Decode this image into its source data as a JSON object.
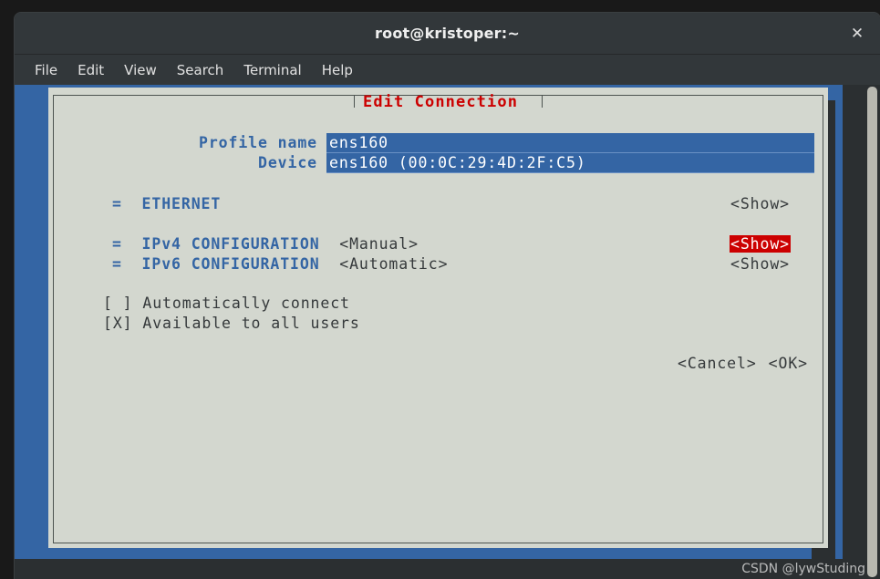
{
  "window": {
    "title": "root@kristoper:~",
    "close_icon": "close-icon",
    "close_glyph": "✕"
  },
  "menubar": {
    "items": [
      {
        "label": "File"
      },
      {
        "label": "Edit"
      },
      {
        "label": "View"
      },
      {
        "label": "Search"
      },
      {
        "label": "Terminal"
      },
      {
        "label": "Help"
      }
    ]
  },
  "dialog": {
    "title": "Edit Connection",
    "title_color": "#cc0000",
    "background": "#d3d7cf",
    "fields": [
      {
        "label": "Profile name",
        "value": "ens160"
      },
      {
        "label": "Device",
        "value": "ens160 (00:0C:29:4D:2F:C5)"
      }
    ],
    "sections": [
      {
        "bullet": "=",
        "name": "ETHERNET",
        "value": "",
        "action": "<Show>",
        "selected": false
      },
      {
        "bullet": "=",
        "name": "IPv4 CONFIGURATION",
        "value": "<Manual>",
        "action": "<Show>",
        "selected": true
      },
      {
        "bullet": "=",
        "name": "IPv6 CONFIGURATION",
        "value": "<Automatic>",
        "action": "<Show>",
        "selected": false
      }
    ],
    "checkboxes": [
      {
        "box": "[ ]",
        "label": "Automatically connect",
        "checked": false
      },
      {
        "box": "[X]",
        "label": "Available to all users",
        "checked": true
      }
    ],
    "buttons": [
      {
        "label": "<Cancel>"
      },
      {
        "label": "<OK>"
      }
    ],
    "selection_color": "#cc0000",
    "accent_blue": "#3465a4"
  },
  "watermark": {
    "text": "CSDN @lywStuding"
  }
}
